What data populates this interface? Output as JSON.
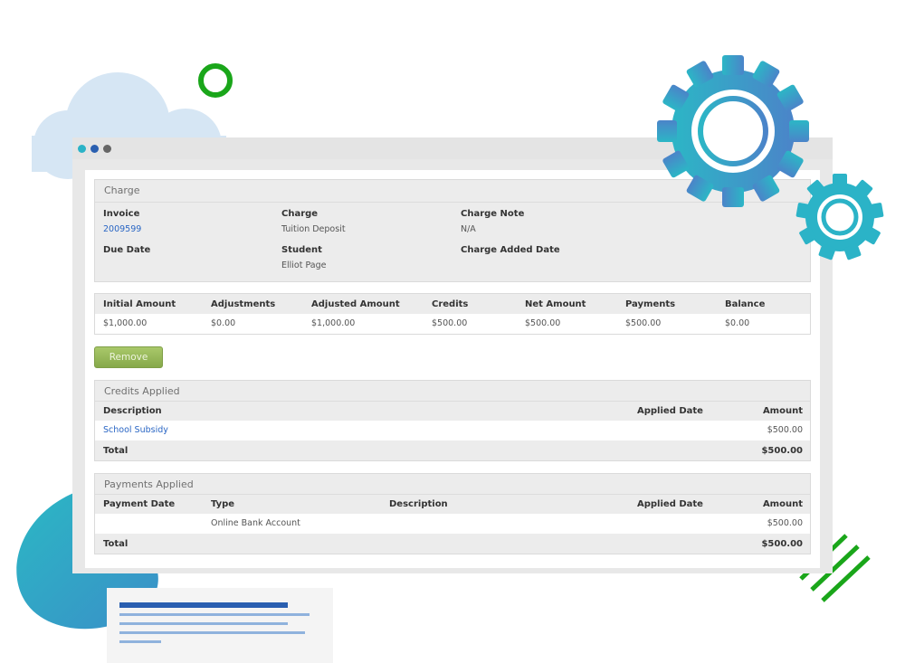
{
  "charge": {
    "title": "Charge",
    "invoice_label": "Invoice",
    "invoice_value": "2009599",
    "charge_label": "Charge",
    "charge_value": "Tuition Deposit",
    "note_label": "Charge Note",
    "note_value": "N/A",
    "due_label": "Due Date",
    "student_label": "Student",
    "student_value": "Elliot Page",
    "added_label": "Charge Added Date"
  },
  "amounts": {
    "headers": [
      "Initial Amount",
      "Adjustments",
      "Adjusted Amount",
      "Credits",
      "Net Amount",
      "Payments",
      "Balance"
    ],
    "values": [
      "$1,000.00",
      "$0.00",
      "$1,000.00",
      "$500.00",
      "$500.00",
      "$500.00",
      "$0.00"
    ]
  },
  "actions": {
    "remove_label": "Remove"
  },
  "credits": {
    "title": "Credits Applied",
    "headers": {
      "description": "Description",
      "applied_date": "Applied Date",
      "amount": "Amount"
    },
    "row": {
      "description": "School Subsidy",
      "amount": "$500.00"
    },
    "total_label": "Total",
    "total_value": "$500.00"
  },
  "payments": {
    "title": "Payments Applied",
    "headers": {
      "payment_date": "Payment Date",
      "type": "Type",
      "description": "Description",
      "applied_date": "Applied Date",
      "amount": "Amount"
    },
    "row": {
      "type": "Online Bank Account",
      "amount": "$500.00"
    },
    "total_label": "Total",
    "total_value": "$500.00"
  },
  "colors": {
    "accent_green": "#1aa61a",
    "gear_teal": "#2bb3c7",
    "gear_blue": "#4b86c9",
    "link_blue": "#2a66c4",
    "button_green": "#94b454",
    "cloud": "#d6e6f4"
  },
  "icons": [
    "cloud-icon",
    "ring-icon",
    "large-gear-icon",
    "small-gear-icon",
    "stripes-icon",
    "blob-icon",
    "document-icon"
  ]
}
